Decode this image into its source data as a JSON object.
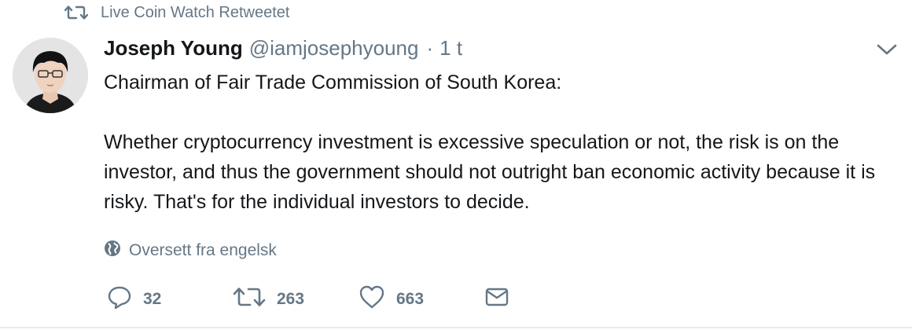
{
  "retweet_context": {
    "text": "Live Coin Watch Retweetet"
  },
  "tweet": {
    "author": {
      "name": "Joseph Young",
      "handle": "@iamjosephyoung",
      "separator": "·",
      "time": "1 t"
    },
    "text": {
      "line1": "Chairman of Fair Trade Commission of South Korea:",
      "line2": "Whether cryptocurrency investment is excessive speculation or not, the risk is on the investor, and thus the government should not outright ban economic activity because it is risky. That's for the individual investors to decide."
    },
    "translate_label": "Oversett fra engelsk",
    "actions": {
      "replies": "32",
      "retweets": "263",
      "likes": "663"
    }
  },
  "icons": {
    "retweet_context": "retweet-icon",
    "menu": "chevron-down-icon",
    "translate": "globe-icon",
    "reply": "reply-icon",
    "retweet": "retweet-icon",
    "like": "heart-icon",
    "dm": "envelope-icon"
  },
  "colors": {
    "text": "#14171a",
    "muted": "#657786",
    "border": "#e6ecf0"
  }
}
